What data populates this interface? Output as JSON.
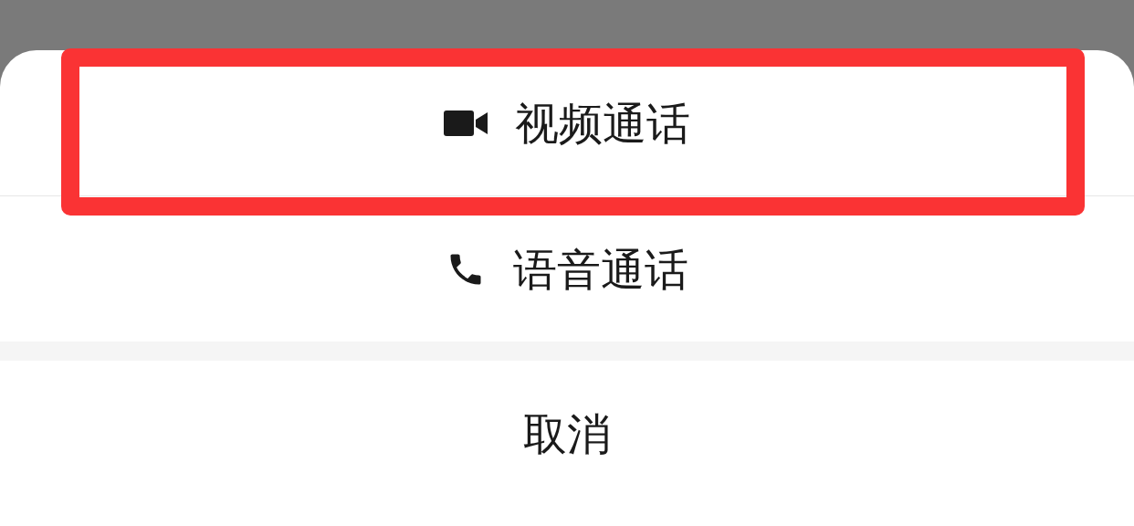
{
  "options": [
    {
      "kind": "video",
      "label": "视频通话",
      "highlighted": true
    },
    {
      "kind": "voice",
      "label": "语音通话",
      "highlighted": false
    }
  ],
  "cancel": {
    "label": "取消"
  }
}
